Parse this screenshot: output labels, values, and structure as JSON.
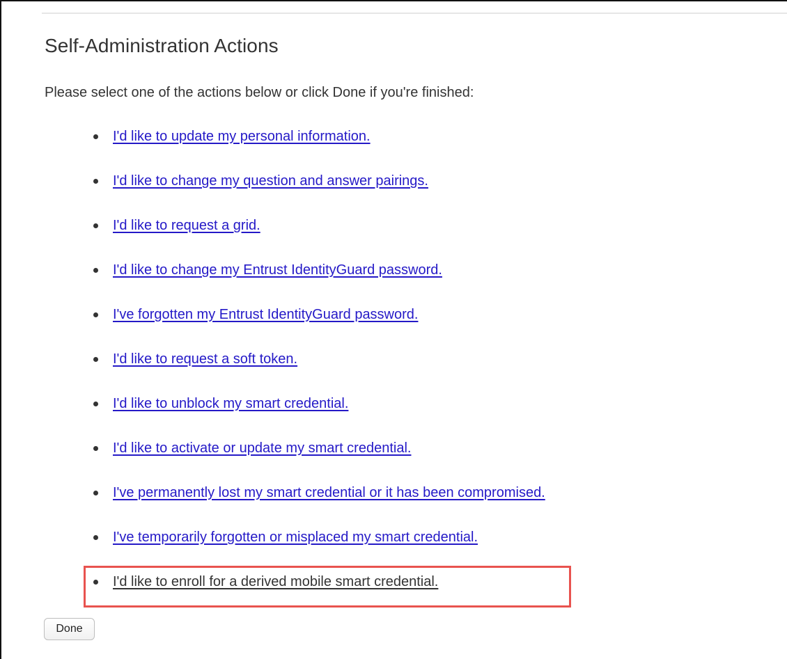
{
  "page": {
    "title": "Self-Administration Actions",
    "intro": "Please select one of the actions below or click Done if you're finished:"
  },
  "actions": [
    {
      "label": "I'd like to update my personal information."
    },
    {
      "label": "I'd like to change my question and answer pairings."
    },
    {
      "label": "I'd like to request a grid."
    },
    {
      "label": "I'd like to change my Entrust IdentityGuard password."
    },
    {
      "label": "I've forgotten my Entrust IdentityGuard password."
    },
    {
      "label": "I'd like to request a soft token."
    },
    {
      "label": "I'd like to unblock my smart credential."
    },
    {
      "label": "I'd like to activate or update my smart credential."
    },
    {
      "label": "I've permanently lost my smart credential or it has been compromised."
    },
    {
      "label": "I've temporarily forgotten or misplaced my smart credential."
    },
    {
      "label": "I'd like to enroll for a derived mobile smart credential.",
      "highlighted": true
    }
  ],
  "done_button": {
    "label": "Done"
  },
  "colors": {
    "link": "#2419c7",
    "text": "#333333",
    "highlight": "#e8534f"
  }
}
